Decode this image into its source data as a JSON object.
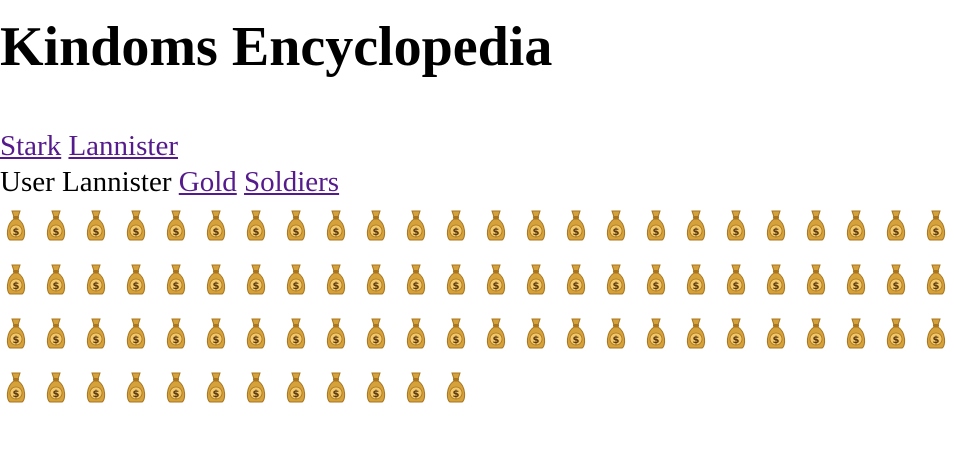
{
  "page": {
    "title": "Kindoms Encyclopedia"
  },
  "house_nav": {
    "links": [
      {
        "label": "Stark"
      },
      {
        "label": "Lannister"
      }
    ]
  },
  "user_line": {
    "label": "User Lannister",
    "links": [
      {
        "label": "Gold"
      },
      {
        "label": "Soldiers"
      }
    ]
  },
  "gold": {
    "icon": "money-bag-icon",
    "count": 84,
    "colors": {
      "bag": "#d4a13a",
      "bag_shadow": "#a8741f",
      "dollar_badge": "#f2c86b",
      "dollar_sign": "#5b3a12"
    }
  },
  "colors": {
    "link": "#551a8b",
    "text": "#000000",
    "background": "#ffffff"
  }
}
